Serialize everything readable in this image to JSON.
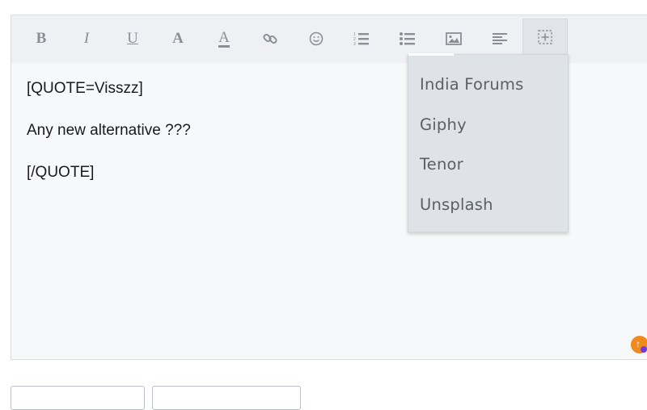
{
  "toolbar": {
    "buttons": [
      {
        "icon": "bold-icon",
        "glyph": "B"
      },
      {
        "icon": "italic-icon",
        "glyph": "I"
      },
      {
        "icon": "underline-icon",
        "glyph": "U"
      },
      {
        "icon": "font-size-icon",
        "glyph": "A"
      },
      {
        "icon": "text-color-icon",
        "glyph": "A"
      },
      {
        "icon": "link-icon"
      },
      {
        "icon": "smiley-icon"
      },
      {
        "icon": "ordered-list-icon"
      },
      {
        "icon": "unordered-list-icon"
      },
      {
        "icon": "image-icon"
      },
      {
        "icon": "align-icon"
      },
      {
        "icon": "insert-media-icon"
      }
    ]
  },
  "content": {
    "lines": [
      "[QUOTE=Visszz]",
      "Any new alternative ???",
      "[/QUOTE]"
    ]
  },
  "media_menu": {
    "items": [
      "India Forums",
      "Giphy",
      "Tenor",
      "Unsplash"
    ]
  },
  "colors": {
    "toolbar_bg": "#eef0f3",
    "editor_bg": "#f7f8f9",
    "menu_bg": "#dfe3e8",
    "badge": "#f08a1c"
  }
}
